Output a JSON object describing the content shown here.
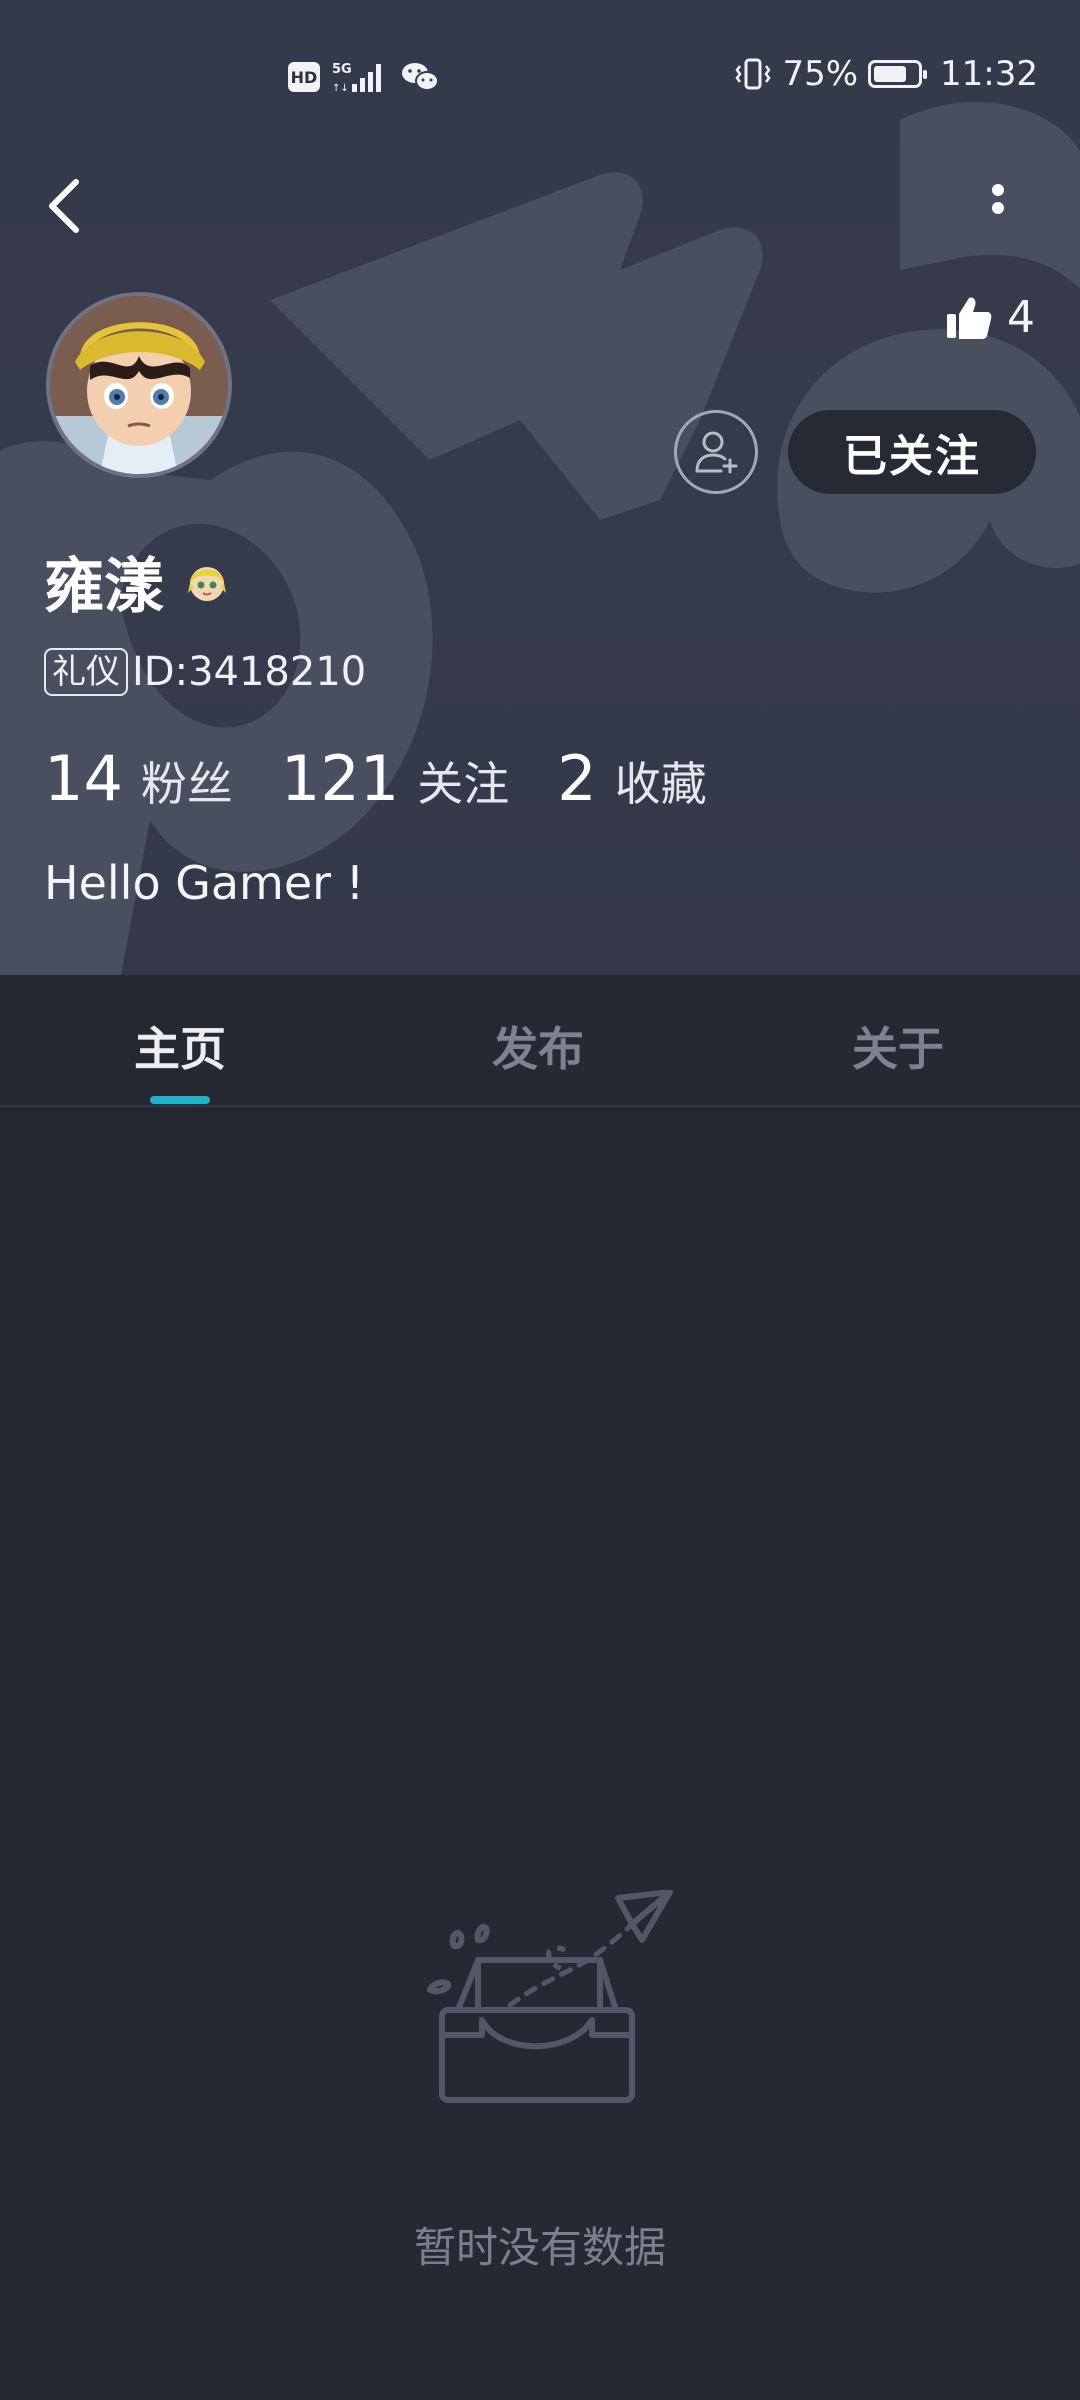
{
  "status_bar": {
    "hd_label": "HD",
    "network_label": "5G",
    "battery_percent": "75%",
    "battery_level": 0.75,
    "time": "11:32",
    "icons": [
      "hd-icon",
      "signal-5g-icon",
      "wechat-icon",
      "vibrate-icon",
      "battery-icon"
    ]
  },
  "profile": {
    "likes_count": "4",
    "follow_button_label": "已关注",
    "username": "雍漾",
    "tag_label": "礼仪",
    "user_id": "ID:3418210",
    "stats": [
      {
        "count": "14",
        "label": "粉丝"
      },
      {
        "count": "121",
        "label": "关注"
      },
      {
        "count": "2",
        "label": "收藏"
      }
    ],
    "bio": "Hello Gamer !"
  },
  "tabs": [
    {
      "label": "主页",
      "active": true
    },
    {
      "label": "发布",
      "active": false
    },
    {
      "label": "关于",
      "active": false
    }
  ],
  "empty_state": {
    "message": "暂时没有数据",
    "icon": "empty-inbox-icon"
  },
  "colors": {
    "header_bg": "#363b4c",
    "page_bg": "#262834",
    "accent": "#1fb3c7"
  }
}
